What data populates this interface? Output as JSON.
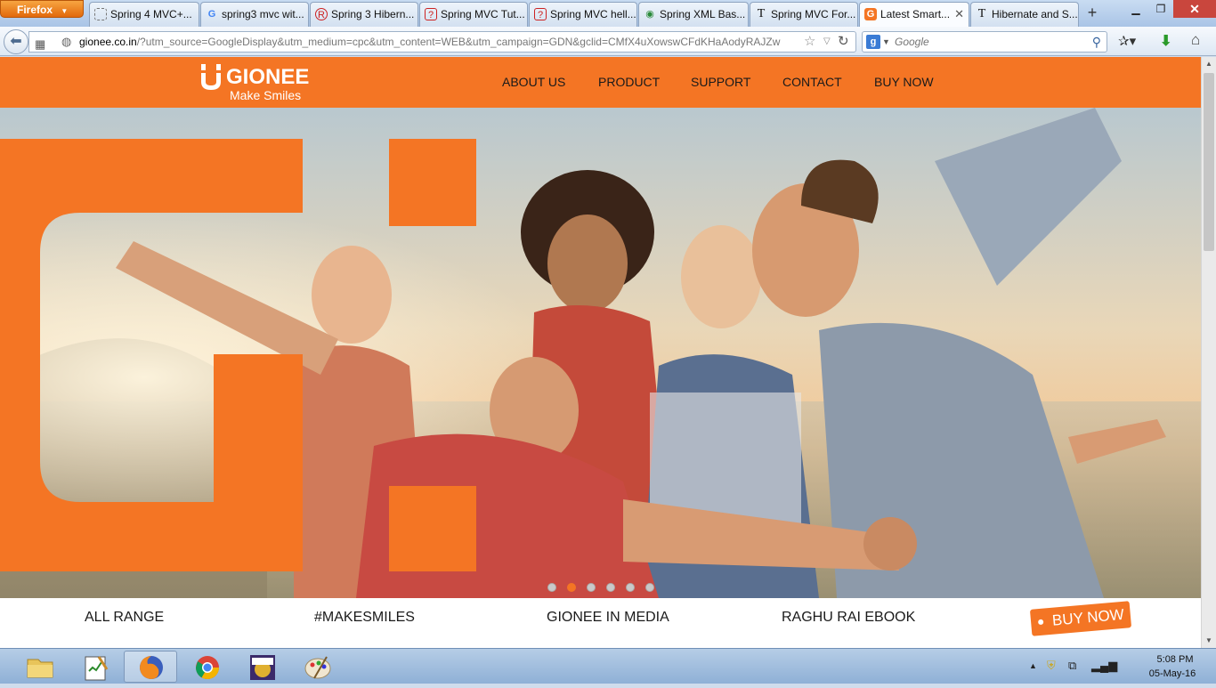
{
  "browser": {
    "app_button_label": "Firefox",
    "tabs": [
      {
        "title": "Spring 4 MVC+...",
        "icon": "page-icon",
        "active": false
      },
      {
        "title": "spring3 mvc wit...",
        "icon": "google-icon",
        "active": false
      },
      {
        "title": "Spring 3 Hibern...",
        "icon": "roseindia-icon",
        "active": false
      },
      {
        "title": "Spring MVC Tut...",
        "icon": "tutorial-icon",
        "active": false
      },
      {
        "title": "Spring MVC hell...",
        "icon": "tutorial-icon",
        "active": false
      },
      {
        "title": "Spring XML Bas...",
        "icon": "map-pin-icon",
        "active": false
      },
      {
        "title": "Spring MVC For...",
        "icon": "t-icon",
        "active": false
      },
      {
        "title": "Latest Smart...",
        "icon": "gionee-icon",
        "active": true
      },
      {
        "title": "Hibernate and S...",
        "icon": "t-icon",
        "active": false
      }
    ],
    "new_tab_label": "+",
    "url_host": "gionee.co.in",
    "url_rest": "/?utm_source=GoogleDisplay&utm_medium=cpc&utm_content=WEB&utm_campaign=GDN&gclid=CMfX4uXowswCFdKHaAodyRAJZw",
    "search_engine": "google-icon",
    "search_placeholder": "Google"
  },
  "site": {
    "logo_text": "GIONEE",
    "tagline": "Make Smiles",
    "nav": [
      "ABOUT US",
      "PRODUCT",
      "SUPPORT",
      "CONTACT",
      "BUY NOW"
    ],
    "brand_color": "#f47524",
    "carousel": {
      "slides": 6,
      "active_index": 1
    },
    "bottom_links": [
      "ALL RANGE",
      "#MAKESMILES",
      "GIONEE IN MEDIA",
      "RAGHU RAI EBOOK"
    ],
    "buy_now_badge": "BUY NOW"
  },
  "taskbar": {
    "apps": [
      "file-explorer-icon",
      "notepad-icon",
      "firefox-icon",
      "chrome-icon",
      "java-ee-ide-icon",
      "paint-icon"
    ],
    "active_app": "firefox-icon",
    "clock_time": "5:08 PM",
    "clock_date": "05-May-16"
  }
}
